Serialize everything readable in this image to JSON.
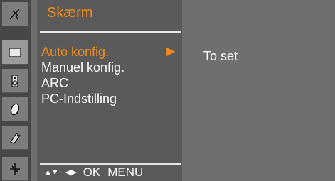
{
  "menu": {
    "title": "Skærm",
    "items": [
      {
        "label": "Auto konfig.",
        "selected": true,
        "arrow": "▶"
      },
      {
        "label": "Manuel konfig.",
        "selected": false
      },
      {
        "label": "ARC",
        "selected": false
      },
      {
        "label": "PC-Indstilling",
        "selected": false
      }
    ]
  },
  "hint": {
    "text": "To set"
  },
  "footer": {
    "updown_glyph": "▲▼",
    "leftright_glyph": "◀▶",
    "ok_label": "OK",
    "menu_label": "MENU"
  },
  "sidebar_icons": [
    "satellite-icon",
    "screen-icon",
    "speaker-icon",
    "clock-icon",
    "tag-icon",
    "options-icon"
  ],
  "colors": {
    "accent": "#f08c1a",
    "menu_panel": "#5a5a5a",
    "background": "#6f6f6f",
    "text": "#ffffff"
  }
}
